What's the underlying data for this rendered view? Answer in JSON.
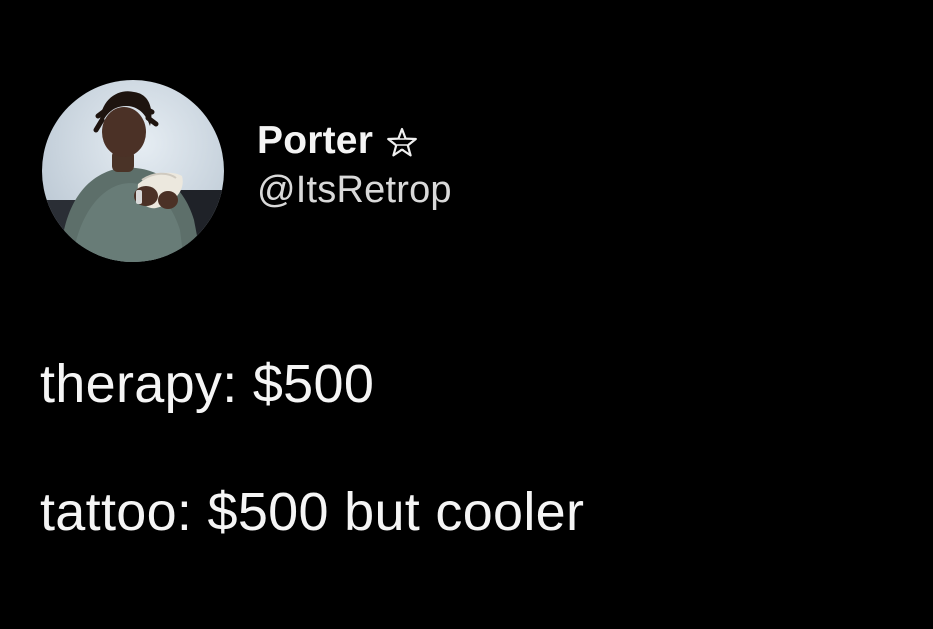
{
  "tweet": {
    "author": {
      "display_name": "Porter",
      "handle": "@ItsRetrop",
      "badge_icon": "star-outline-icon",
      "avatar_icon": "profile-photo-avatar"
    },
    "text_lines": [
      "therapy: $500",
      "tattoo: $500 but cooler"
    ]
  },
  "colors": {
    "background": "#000000",
    "text_primary": "#f5f5f5",
    "text_secondary": "#d9d9d9"
  }
}
